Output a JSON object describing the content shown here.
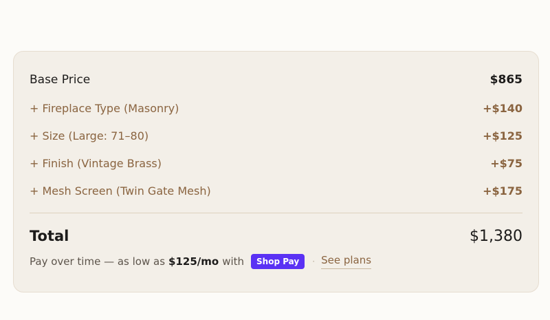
{
  "breakdown": {
    "base": {
      "label": "Base Price",
      "price": "$865"
    },
    "options": [
      {
        "label": "+ Fireplace Type (Masonry)",
        "price": "+$140"
      },
      {
        "label": "+ Size (Large: 71–80)",
        "price": "+$125"
      },
      {
        "label": "+ Finish (Vintage Brass)",
        "price": "+$75"
      },
      {
        "label": "+ Mesh Screen (Twin Gate Mesh)",
        "price": "+$175"
      }
    ],
    "total": {
      "label": "Total",
      "value": "$1,380"
    }
  },
  "financing": {
    "prefix": "Pay over time — as low as",
    "amount": "$125/mo",
    "with": "with",
    "badge": "Shop Pay",
    "separator": "·",
    "link": "See plans"
  },
  "colors": {
    "card_bg": "#f3efe8",
    "option_text": "#8a6440",
    "shop_pay": "#5a31f4"
  }
}
